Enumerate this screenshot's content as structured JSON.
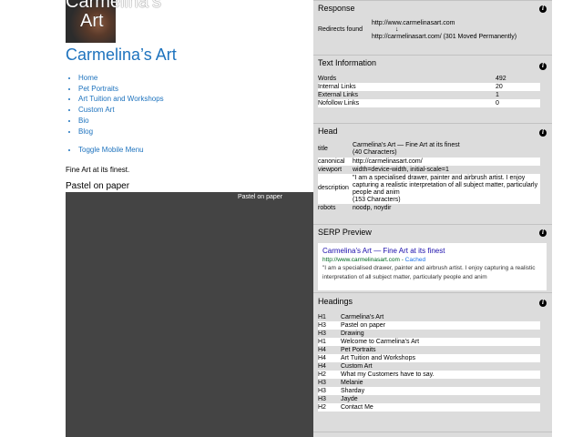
{
  "site": {
    "logo_line1": "Carmelina's",
    "logo_line2": "Art",
    "title": "Carmelina’s Art",
    "nav": [
      "Home",
      "Pet Portraits",
      "Art Tuition and Workshops",
      "Custom Art",
      "Bio",
      "Blog"
    ],
    "toggle_menu": "Toggle Mobile Menu",
    "tagline": "Fine Art at its finest.",
    "section_heading": "Pastel on paper",
    "gallery_label": "Pastel on paper"
  },
  "panel": {
    "response": {
      "title": "Response",
      "label": "Redirects found",
      "from_url": "http://www.carmelinasart.com",
      "arrow": "↓",
      "to_url": "http://carmelinasart.com/ (301 Moved Permanently)"
    },
    "text_info": {
      "title": "Text Information",
      "rows": [
        {
          "k": "Words",
          "v": "492"
        },
        {
          "k": "Internal Links",
          "v": "20"
        },
        {
          "k": "External Links",
          "v": "1"
        },
        {
          "k": "Nofollow Links",
          "v": "0"
        }
      ]
    },
    "head": {
      "title": "Head",
      "title_label": "title",
      "title_value": "Carmelina's Art — Fine Art at its finest",
      "title_chars": "(40 Characters)",
      "canonical_label": "canonical",
      "canonical_value": "http://carmelinasart.com/",
      "viewport_label": "viewport",
      "viewport_value": "width=device-width, initial-scale=1",
      "description_label": "description",
      "description_value": "\"I am a specialised drawer, painter and airbrush artist. I enjoy capturing a realistic interpretation of all subject matter, particularly people and anim",
      "description_chars": "(153 Characters)",
      "robots_label": "robots",
      "robots_value": "noodp, noydir"
    },
    "serp": {
      "title": "SERP Preview",
      "result_title": "Carmelina's Art — Fine Art at its finest",
      "result_url": "http://www.carmelinasart.com",
      "cached": "Cached",
      "result_desc": "\"I am a specialised drawer, painter and airbrush artist. I enjoy capturing a realistic interpretation of all subject matter, particularly people and anim"
    },
    "headings": {
      "title": "Headings",
      "rows": [
        {
          "k": "H1",
          "v": "Carmelina's Art"
        },
        {
          "k": "H3",
          "v": "Pastel on paper"
        },
        {
          "k": "H3",
          "v": "Drawing"
        },
        {
          "k": "H1",
          "v": "Welcome to Carmelina's Art"
        },
        {
          "k": "H4",
          "v": "Pet Portraits"
        },
        {
          "k": "H4",
          "v": "Art Tuition and Workshops"
        },
        {
          "k": "H4",
          "v": "Custom Art"
        },
        {
          "k": "H2",
          "v": "What my Customers have to say."
        },
        {
          "k": "H3",
          "v": "Melanie"
        },
        {
          "k": "H3",
          "v": "Sharday"
        },
        {
          "k": "H3",
          "v": "Jayde"
        },
        {
          "k": "H2",
          "v": "Contact Me"
        }
      ]
    },
    "info_icon": "i"
  }
}
